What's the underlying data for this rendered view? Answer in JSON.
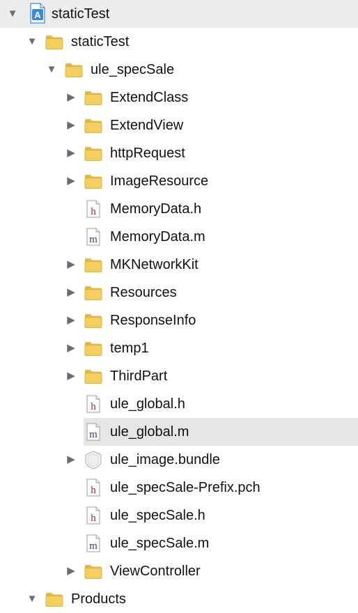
{
  "project_navigator": {
    "rows": [
      {
        "label": "staticTest",
        "kind": "project",
        "disclosure": "open",
        "depth": 0
      },
      {
        "label": "staticTest",
        "kind": "folder",
        "disclosure": "open",
        "depth": 1
      },
      {
        "label": "ule_specSale",
        "kind": "folder",
        "disclosure": "open",
        "depth": 2
      },
      {
        "label": "ExtendClass",
        "kind": "folder",
        "disclosure": "closed",
        "depth": 3
      },
      {
        "label": "ExtendView",
        "kind": "folder",
        "disclosure": "closed",
        "depth": 3
      },
      {
        "label": "httpRequest",
        "kind": "folder",
        "disclosure": "closed",
        "depth": 3
      },
      {
        "label": "ImageResource",
        "kind": "folder",
        "disclosure": "closed",
        "depth": 3
      },
      {
        "label": "MemoryData.h",
        "kind": "header-file",
        "disclosure": "none",
        "depth": 3
      },
      {
        "label": "MemoryData.m",
        "kind": "implementation-file",
        "disclosure": "none",
        "depth": 3
      },
      {
        "label": "MKNetworkKit",
        "kind": "folder",
        "disclosure": "closed",
        "depth": 3
      },
      {
        "label": "Resources",
        "kind": "folder",
        "disclosure": "closed",
        "depth": 3
      },
      {
        "label": "ResponseInfo",
        "kind": "folder",
        "disclosure": "closed",
        "depth": 3
      },
      {
        "label": "temp1",
        "kind": "folder",
        "disclosure": "closed",
        "depth": 3
      },
      {
        "label": "ThirdPart",
        "kind": "folder",
        "disclosure": "closed",
        "depth": 3
      },
      {
        "label": "ule_global.h",
        "kind": "header-file",
        "disclosure": "none",
        "depth": 3
      },
      {
        "label": "ule_global.m",
        "kind": "implementation-file",
        "disclosure": "none",
        "depth": 3,
        "selected": true
      },
      {
        "label": "ule_image.bundle",
        "kind": "bundle",
        "disclosure": "closed",
        "depth": 3
      },
      {
        "label": "ule_specSale-Prefix.pch",
        "kind": "header-file",
        "disclosure": "none",
        "depth": 3
      },
      {
        "label": "ule_specSale.h",
        "kind": "header-file",
        "disclosure": "none",
        "depth": 3
      },
      {
        "label": "ule_specSale.m",
        "kind": "implementation-file",
        "disclosure": "none",
        "depth": 3
      },
      {
        "label": "ViewController",
        "kind": "folder",
        "disclosure": "closed",
        "depth": 3
      },
      {
        "label": "Products",
        "kind": "folder",
        "disclosure": "open",
        "depth": 1
      }
    ]
  },
  "icons": {
    "project": "xcode-project-icon",
    "folder": "folder-icon",
    "header-file": "h-file-icon",
    "implementation-file": "m-file-icon",
    "bundle": "bundle-icon",
    "open": "disclosure-open-icon",
    "closed": "disclosure-closed-icon"
  },
  "colors": {
    "folder": "#f3cf62",
    "header_letter": "#9a2a2a",
    "impl_letter": "#3a3a8c",
    "project_blue": "#3b8ad9",
    "selection": "#e6e6e6"
  }
}
